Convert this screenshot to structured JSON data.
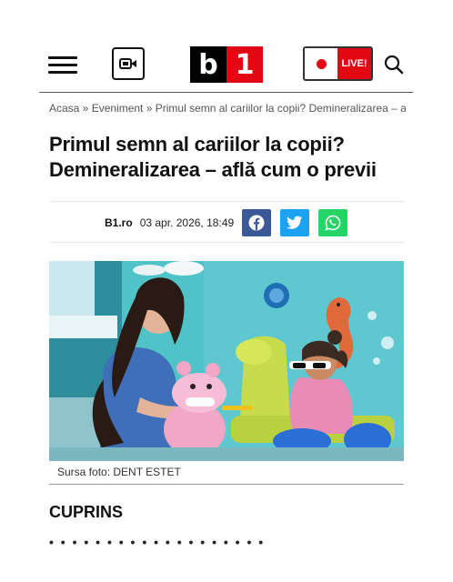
{
  "header": {
    "menu_icon": "hamburger-icon",
    "video_icon": "video-camera-icon",
    "logo_b": "b",
    "logo_1": "1",
    "live_label": "LIVE!",
    "search_icon": "search-icon"
  },
  "breadcrumb": "Acasa » Eveniment » Primul semn al cariilor la copii? Demineralizarea – af",
  "article": {
    "title": "Primul semn al cariilor la copii? Demineralizarea – află cum o previi",
    "author": "B1.ro",
    "date": "03 apr. 2026, 18:49",
    "share_icons": [
      "facebook-icon",
      "twitter-icon",
      "whatsapp-icon"
    ],
    "photo_caption": "Sursa foto: DENT ESTET"
  },
  "toc": {
    "heading": "CUPRINS"
  },
  "colors": {
    "brand_red": "#e30613",
    "facebook": "#3b5998",
    "twitter": "#1da1f2",
    "whatsapp": "#25d366"
  }
}
